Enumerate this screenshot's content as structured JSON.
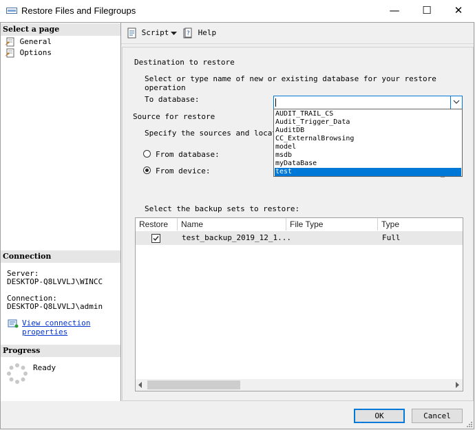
{
  "window": {
    "title": "Restore Files and Filegroups",
    "minimize": "—",
    "maximize": "☐",
    "close": "✕"
  },
  "left_pane": {
    "select_page_header": "Select a page",
    "pages": [
      {
        "label": "General",
        "icon": "page-wrench-icon"
      },
      {
        "label": "Options",
        "icon": "page-wrench-icon"
      }
    ],
    "connection_header": "Connection",
    "server_label": "Server:",
    "server_value": "DESKTOP-Q8LVVLJ\\WINCC",
    "connection_label": "Connection:",
    "connection_value": "DESKTOP-Q8LVVLJ\\admin",
    "view_connection_line1": "View connection",
    "view_connection_line2": "properties",
    "progress_header": "Progress",
    "progress_status": "Ready"
  },
  "toolbar": {
    "script_label": "Script",
    "help_label": "Help"
  },
  "main": {
    "destination_header": "Destination to restore",
    "destination_desc": "Select or type name of new or existing database for your restore operation",
    "to_database_label": "To database:",
    "to_database_value": "",
    "source_header": "Source for restore",
    "source_desc": "Specify the sources and locatio",
    "from_database_label": "From database:",
    "from_device_label": "From device:",
    "from_device_selected": true,
    "backup_sets_label": "Select the backup sets to restore:"
  },
  "dropdown": {
    "options": [
      "AUDIT_TRAIL_CS",
      "Audit_Trigger_Data",
      "AuditDB",
      "CC_ExternalBrowsing",
      "model",
      "msdb",
      "myDataBase",
      "test"
    ],
    "highlighted": "test"
  },
  "grid": {
    "columns": [
      "Restore",
      "Name",
      "File Type",
      "Type"
    ],
    "rows": [
      {
        "restore": true,
        "name": "test_backup_2019_12_1...",
        "file_type": "",
        "type": "Full"
      }
    ]
  },
  "buttons": {
    "ok": "OK",
    "cancel": "Cancel"
  },
  "colors": {
    "accent": "#0078d7",
    "link": "#0033cc"
  }
}
